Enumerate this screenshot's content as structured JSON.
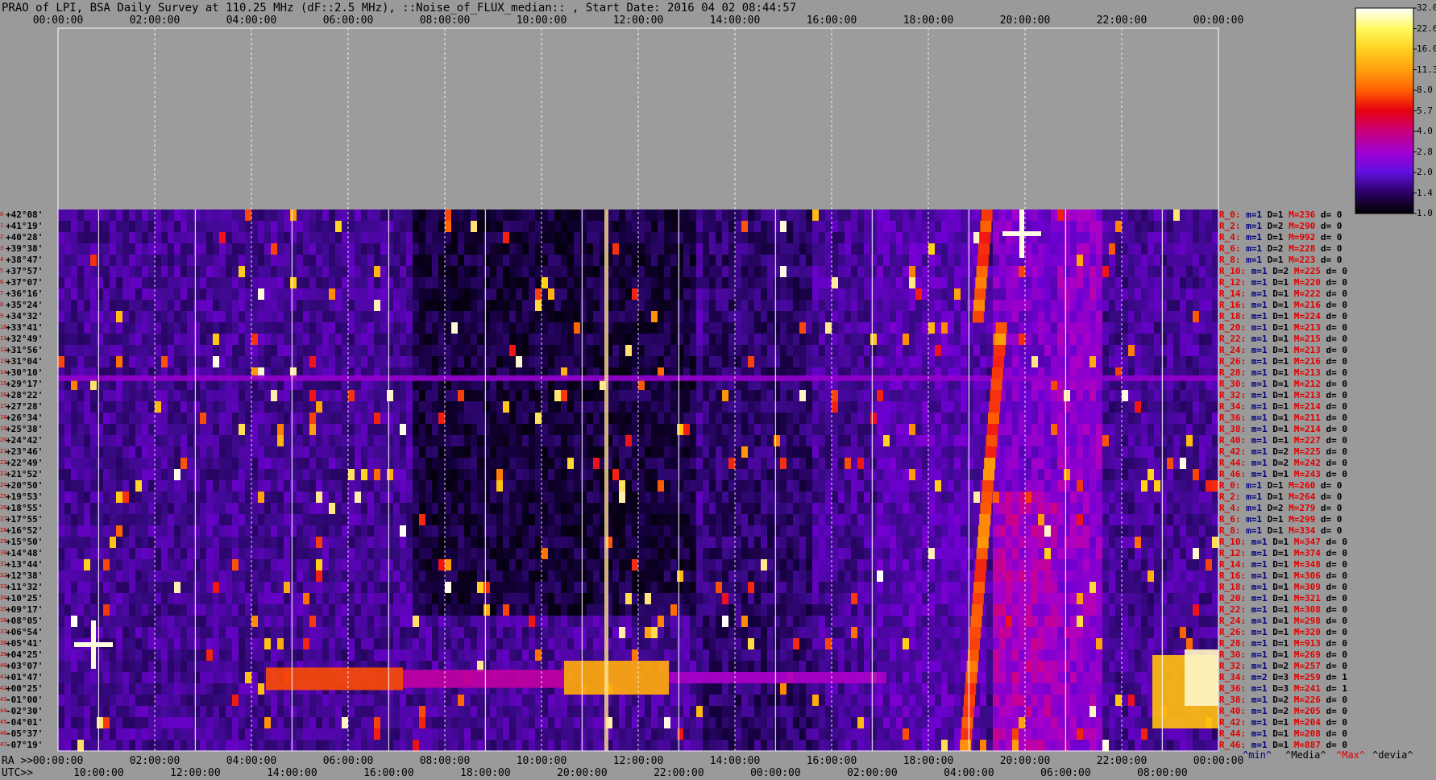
{
  "title": "PRAO of LPI, BSA Daily Survey at 110.25 MHz (dF::2.5 MHz), ::Noise_of_FLUX_median:: , Start Date: 2016 04 02 08:44:57",
  "chart_data": {
    "type": "heatmap",
    "x_top_ticks": [
      "00:00:00",
      "02:00:00",
      "04:00:00",
      "06:00:00",
      "08:00:00",
      "10:00:00",
      "12:00:00",
      "14:00:00",
      "16:00:00",
      "18:00:00",
      "20:00:00",
      "22:00:00",
      "00:00:00"
    ],
    "x_ra_prefix": "RA >>",
    "x_ra_ticks": [
      "00:00:00",
      "02:00:00",
      "04:00:00",
      "06:00:00",
      "08:00:00",
      "10:00:00",
      "12:00:00",
      "14:00:00",
      "16:00:00",
      "18:00:00",
      "20:00:00",
      "22:00:00",
      "00:00:00"
    ],
    "x_utc_prefix": "UTC>>",
    "x_utc_ticks": [
      "10:00:00",
      "12:00:00",
      "14:00:00",
      "16:00:00",
      "18:00:00",
      "20:00:00",
      "22:00:00",
      "00:00:00",
      "02:00:00",
      "04:00:00",
      "06:00:00",
      "08:00:00"
    ],
    "y_dec_labels": [
      "+42°08'",
      "+41°19'",
      "+40°28'",
      "+39°38'",
      "+38°47'",
      "+37°57'",
      "+37°07'",
      "+36°16'",
      "+35°24'",
      "+34°32'",
      "+33°41'",
      "+32°49'",
      "+31°56'",
      "+31°04'",
      "+30°10'",
      "+29°17'",
      "+28°22'",
      "+27°28'",
      "+26°34'",
      "+25°38'",
      "+24°42'",
      "+23°46'",
      "+22°49'",
      "+21°52'",
      "+20°50'",
      "+19°53'",
      "+18°55'",
      "+17°55'",
      "+16°52'",
      "+15°50'",
      "+14°48'",
      "+13°44'",
      "+12°38'",
      "+11°32'",
      "+10°25'",
      "+09°17'",
      "+08°05'",
      "+06°54'",
      "+05°41'",
      "+04°25'",
      "+03°07'",
      "+01°47'",
      "+00°25'",
      "-01°00'",
      "-02°30'",
      "-04°01'",
      "-05°37'",
      "-07°19'"
    ],
    "colorbar_ticks": [
      "32.0",
      "22.6",
      "16.0",
      "11.3",
      "8.0",
      "5.7",
      "4.0",
      "2.8",
      "2.0",
      "1.4",
      "1.0"
    ],
    "colorbar_colors": [
      "#ffffff",
      "#fffa60",
      "#ffd020",
      "#ffa010",
      "#ff6000",
      "#e80010",
      "#c8007a",
      "#a000d0",
      "#6010e0",
      "#2a0060",
      "#000000"
    ],
    "row_stats": [
      {
        "r": "R_0:",
        "m": "1",
        "D": "1",
        "M": "236",
        "d": "0"
      },
      {
        "r": "R_2:",
        "m": "1",
        "D": "2",
        "M": "290",
        "d": "0"
      },
      {
        "r": "R_4:",
        "m": "1",
        "D": "1",
        "M": "992",
        "d": "0"
      },
      {
        "r": "R_6:",
        "m": "1",
        "D": "2",
        "M": "228",
        "d": "0"
      },
      {
        "r": "R_8:",
        "m": "1",
        "D": "1",
        "M": "223",
        "d": "0"
      },
      {
        "r": "R_10:",
        "m": "1",
        "D": "2",
        "M": "225",
        "d": "0"
      },
      {
        "r": "R_12:",
        "m": "1",
        "D": "1",
        "M": "220",
        "d": "0"
      },
      {
        "r": "R_14:",
        "m": "1",
        "D": "1",
        "M": "222",
        "d": "0"
      },
      {
        "r": "R_16:",
        "m": "1",
        "D": "1",
        "M": "216",
        "d": "0"
      },
      {
        "r": "R_18:",
        "m": "1",
        "D": "1",
        "M": "224",
        "d": "0"
      },
      {
        "r": "R_20:",
        "m": "1",
        "D": "1",
        "M": "213",
        "d": "0"
      },
      {
        "r": "R_22:",
        "m": "1",
        "D": "1",
        "M": "215",
        "d": "0"
      },
      {
        "r": "R_24:",
        "m": "1",
        "D": "1",
        "M": "213",
        "d": "0"
      },
      {
        "r": "R_26:",
        "m": "1",
        "D": "1",
        "M": "216",
        "d": "0"
      },
      {
        "r": "R_28:",
        "m": "1",
        "D": "1",
        "M": "213",
        "d": "0"
      },
      {
        "r": "R_30:",
        "m": "1",
        "D": "1",
        "M": "212",
        "d": "0"
      },
      {
        "r": "R_32:",
        "m": "1",
        "D": "1",
        "M": "213",
        "d": "0"
      },
      {
        "r": "R_34:",
        "m": "1",
        "D": "1",
        "M": "214",
        "d": "0"
      },
      {
        "r": "R_36:",
        "m": "1",
        "D": "1",
        "M": "211",
        "d": "0"
      },
      {
        "r": "R_38:",
        "m": "1",
        "D": "1",
        "M": "214",
        "d": "0"
      },
      {
        "r": "R_40:",
        "m": "1",
        "D": "1",
        "M": "227",
        "d": "0"
      },
      {
        "r": "R_42:",
        "m": "1",
        "D": "2",
        "M": "225",
        "d": "0"
      },
      {
        "r": "R_44:",
        "m": "1",
        "D": "2",
        "M": "242",
        "d": "0"
      },
      {
        "r": "R_46:",
        "m": "1",
        "D": "1",
        "M": "243",
        "d": "0"
      },
      {
        "r": "R_0:",
        "m": "1",
        "D": "1",
        "M": "260",
        "d": "0"
      },
      {
        "r": "R_2:",
        "m": "1",
        "D": "1",
        "M": "264",
        "d": "0"
      },
      {
        "r": "R_4:",
        "m": "1",
        "D": "2",
        "M": "279",
        "d": "0"
      },
      {
        "r": "R_6:",
        "m": "1",
        "D": "1",
        "M": "299",
        "d": "0"
      },
      {
        "r": "R_8:",
        "m": "1",
        "D": "1",
        "M": "334",
        "d": "0"
      },
      {
        "r": "R_10:",
        "m": "1",
        "D": "1",
        "M": "347",
        "d": "0"
      },
      {
        "r": "R_12:",
        "m": "1",
        "D": "1",
        "M": "374",
        "d": "0"
      },
      {
        "r": "R_14:",
        "m": "1",
        "D": "1",
        "M": "348",
        "d": "0"
      },
      {
        "r": "R_16:",
        "m": "1",
        "D": "1",
        "M": "306",
        "d": "0"
      },
      {
        "r": "R_18:",
        "m": "1",
        "D": "1",
        "M": "309",
        "d": "0"
      },
      {
        "r": "R_20:",
        "m": "1",
        "D": "1",
        "M": "321",
        "d": "0"
      },
      {
        "r": "R_22:",
        "m": "1",
        "D": "1",
        "M": "308",
        "d": "0"
      },
      {
        "r": "R_24:",
        "m": "1",
        "D": "1",
        "M": "298",
        "d": "0"
      },
      {
        "r": "R_26:",
        "m": "1",
        "D": "1",
        "M": "320",
        "d": "0"
      },
      {
        "r": "R_28:",
        "m": "1",
        "D": "1",
        "M": "913",
        "d": "0"
      },
      {
        "r": "R_30:",
        "m": "1",
        "D": "1",
        "M": "269",
        "d": "0"
      },
      {
        "r": "R_32:",
        "m": "1",
        "D": "2",
        "M": "257",
        "d": "0"
      },
      {
        "r": "R_34:",
        "m": "2",
        "D": "3",
        "M": "259",
        "d": "1"
      },
      {
        "r": "R_36:",
        "m": "1",
        "D": "3",
        "M": "241",
        "d": "1"
      },
      {
        "r": "R_38:",
        "m": "1",
        "D": "2",
        "M": "226",
        "d": "0"
      },
      {
        "r": "R_40:",
        "m": "1",
        "D": "2",
        "M": "205",
        "d": "0"
      },
      {
        "r": "R_42:",
        "m": "1",
        "D": "1",
        "M": "204",
        "d": "0"
      },
      {
        "r": "R_44:",
        "m": "1",
        "D": "1",
        "M": "208",
        "d": "0"
      },
      {
        "r": "R_46:",
        "m": "1",
        "D": "1",
        "M": "887",
        "d": "0"
      }
    ],
    "legend": {
      "min": "^min^",
      "media": "^Media^",
      "max": "^Max^",
      "devia": "^devia^"
    }
  }
}
